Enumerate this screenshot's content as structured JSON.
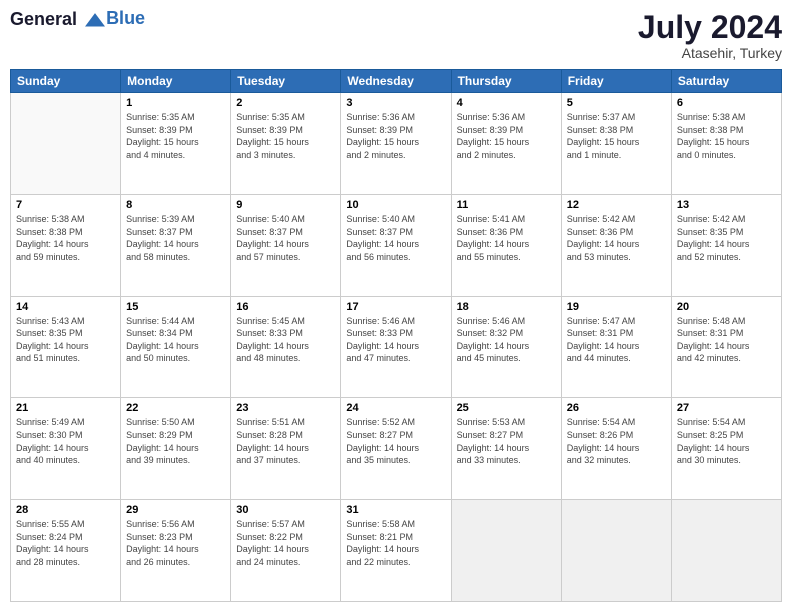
{
  "header": {
    "logo_line1": "General",
    "logo_line2": "Blue",
    "month_year": "July 2024",
    "location": "Atasehir, Turkey"
  },
  "weekdays": [
    "Sunday",
    "Monday",
    "Tuesday",
    "Wednesday",
    "Thursday",
    "Friday",
    "Saturday"
  ],
  "weeks": [
    [
      {
        "day": "",
        "info": ""
      },
      {
        "day": "1",
        "info": "Sunrise: 5:35 AM\nSunset: 8:39 PM\nDaylight: 15 hours\nand 4 minutes."
      },
      {
        "day": "2",
        "info": "Sunrise: 5:35 AM\nSunset: 8:39 PM\nDaylight: 15 hours\nand 3 minutes."
      },
      {
        "day": "3",
        "info": "Sunrise: 5:36 AM\nSunset: 8:39 PM\nDaylight: 15 hours\nand 2 minutes."
      },
      {
        "day": "4",
        "info": "Sunrise: 5:36 AM\nSunset: 8:39 PM\nDaylight: 15 hours\nand 2 minutes."
      },
      {
        "day": "5",
        "info": "Sunrise: 5:37 AM\nSunset: 8:38 PM\nDaylight: 15 hours\nand 1 minute."
      },
      {
        "day": "6",
        "info": "Sunrise: 5:38 AM\nSunset: 8:38 PM\nDaylight: 15 hours\nand 0 minutes."
      }
    ],
    [
      {
        "day": "7",
        "info": "Sunrise: 5:38 AM\nSunset: 8:38 PM\nDaylight: 14 hours\nand 59 minutes."
      },
      {
        "day": "8",
        "info": "Sunrise: 5:39 AM\nSunset: 8:37 PM\nDaylight: 14 hours\nand 58 minutes."
      },
      {
        "day": "9",
        "info": "Sunrise: 5:40 AM\nSunset: 8:37 PM\nDaylight: 14 hours\nand 57 minutes."
      },
      {
        "day": "10",
        "info": "Sunrise: 5:40 AM\nSunset: 8:37 PM\nDaylight: 14 hours\nand 56 minutes."
      },
      {
        "day": "11",
        "info": "Sunrise: 5:41 AM\nSunset: 8:36 PM\nDaylight: 14 hours\nand 55 minutes."
      },
      {
        "day": "12",
        "info": "Sunrise: 5:42 AM\nSunset: 8:36 PM\nDaylight: 14 hours\nand 53 minutes."
      },
      {
        "day": "13",
        "info": "Sunrise: 5:42 AM\nSunset: 8:35 PM\nDaylight: 14 hours\nand 52 minutes."
      }
    ],
    [
      {
        "day": "14",
        "info": "Sunrise: 5:43 AM\nSunset: 8:35 PM\nDaylight: 14 hours\nand 51 minutes."
      },
      {
        "day": "15",
        "info": "Sunrise: 5:44 AM\nSunset: 8:34 PM\nDaylight: 14 hours\nand 50 minutes."
      },
      {
        "day": "16",
        "info": "Sunrise: 5:45 AM\nSunset: 8:33 PM\nDaylight: 14 hours\nand 48 minutes."
      },
      {
        "day": "17",
        "info": "Sunrise: 5:46 AM\nSunset: 8:33 PM\nDaylight: 14 hours\nand 47 minutes."
      },
      {
        "day": "18",
        "info": "Sunrise: 5:46 AM\nSunset: 8:32 PM\nDaylight: 14 hours\nand 45 minutes."
      },
      {
        "day": "19",
        "info": "Sunrise: 5:47 AM\nSunset: 8:31 PM\nDaylight: 14 hours\nand 44 minutes."
      },
      {
        "day": "20",
        "info": "Sunrise: 5:48 AM\nSunset: 8:31 PM\nDaylight: 14 hours\nand 42 minutes."
      }
    ],
    [
      {
        "day": "21",
        "info": "Sunrise: 5:49 AM\nSunset: 8:30 PM\nDaylight: 14 hours\nand 40 minutes."
      },
      {
        "day": "22",
        "info": "Sunrise: 5:50 AM\nSunset: 8:29 PM\nDaylight: 14 hours\nand 39 minutes."
      },
      {
        "day": "23",
        "info": "Sunrise: 5:51 AM\nSunset: 8:28 PM\nDaylight: 14 hours\nand 37 minutes."
      },
      {
        "day": "24",
        "info": "Sunrise: 5:52 AM\nSunset: 8:27 PM\nDaylight: 14 hours\nand 35 minutes."
      },
      {
        "day": "25",
        "info": "Sunrise: 5:53 AM\nSunset: 8:27 PM\nDaylight: 14 hours\nand 33 minutes."
      },
      {
        "day": "26",
        "info": "Sunrise: 5:54 AM\nSunset: 8:26 PM\nDaylight: 14 hours\nand 32 minutes."
      },
      {
        "day": "27",
        "info": "Sunrise: 5:54 AM\nSunset: 8:25 PM\nDaylight: 14 hours\nand 30 minutes."
      }
    ],
    [
      {
        "day": "28",
        "info": "Sunrise: 5:55 AM\nSunset: 8:24 PM\nDaylight: 14 hours\nand 28 minutes."
      },
      {
        "day": "29",
        "info": "Sunrise: 5:56 AM\nSunset: 8:23 PM\nDaylight: 14 hours\nand 26 minutes."
      },
      {
        "day": "30",
        "info": "Sunrise: 5:57 AM\nSunset: 8:22 PM\nDaylight: 14 hours\nand 24 minutes."
      },
      {
        "day": "31",
        "info": "Sunrise: 5:58 AM\nSunset: 8:21 PM\nDaylight: 14 hours\nand 22 minutes."
      },
      {
        "day": "",
        "info": ""
      },
      {
        "day": "",
        "info": ""
      },
      {
        "day": "",
        "info": ""
      }
    ]
  ]
}
